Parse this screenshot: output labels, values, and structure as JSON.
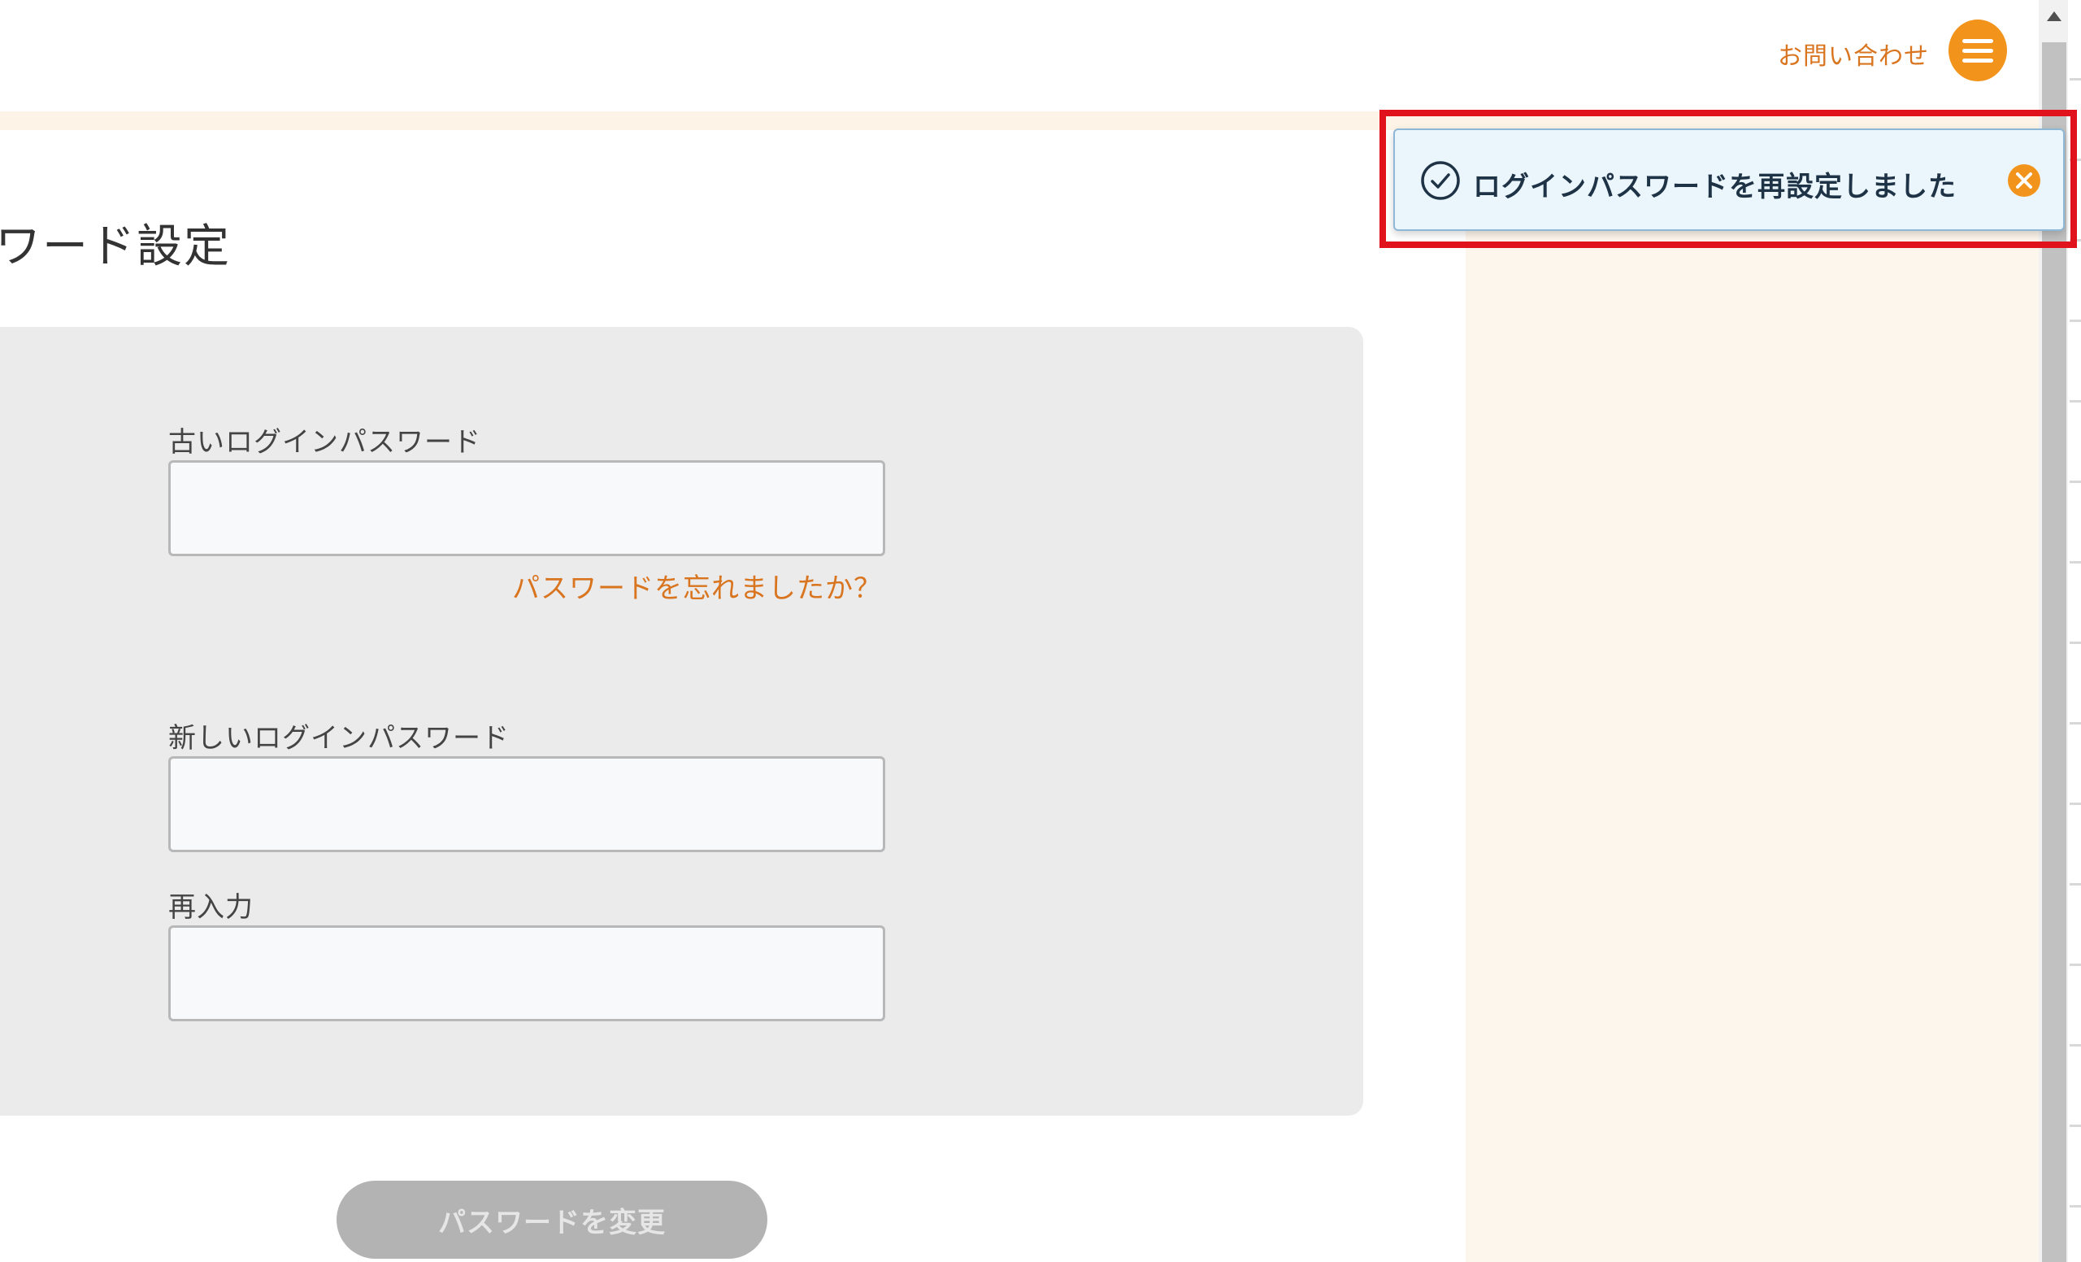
{
  "header": {
    "contact_label": "お問い合わせ",
    "menu_icon": "hamburger-menu-icon"
  },
  "page": {
    "title": "ワード設定"
  },
  "form": {
    "old_password_label": "古いログインパスワード",
    "old_password_value": "",
    "forgot_link": "パスワードを忘れましたか？",
    "new_password_label": "新しいログインパスワード",
    "new_password_value": "",
    "confirm_label": "再入力",
    "confirm_value": "",
    "submit_label": "パスワードを変更"
  },
  "toast": {
    "icon": "check-circle-icon",
    "message": "ログインパスワードを再設定しました",
    "close_icon": "close-circle-icon"
  },
  "colors": {
    "accent": "#f2931b",
    "link": "#d9741f",
    "toast_bg": "#ebf6fc",
    "highlight": "#e0121b",
    "side_panel": "#fdf6ec",
    "card_bg": "#ebebeb"
  }
}
